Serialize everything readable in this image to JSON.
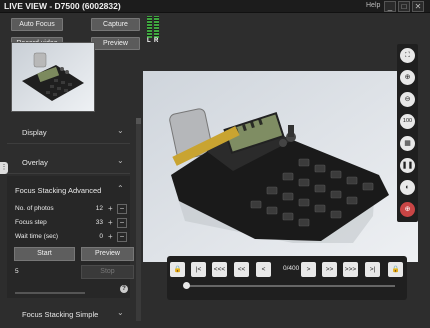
{
  "window": {
    "title": "LIVE VIEW - D7500 (6002832)",
    "help": "Help",
    "min": "_",
    "max": "□",
    "close": "✕"
  },
  "buttons": {
    "auto_focus": "Auto Focus",
    "capture": "Capture",
    "record_video": "Record video",
    "preview": "Preview"
  },
  "meter": {
    "left": "L",
    "right": "R"
  },
  "panels": {
    "display": "Display",
    "overlay": "Overlay",
    "focus_stacking_simple": "Focus Stacking Simple"
  },
  "focus_stacking_advanced": {
    "title": "Focus Stacking Advanced",
    "rows": [
      {
        "label": "No. of photos",
        "value": "12"
      },
      {
        "label": "Focus step",
        "value": "33"
      },
      {
        "label": "Wait time (sec)",
        "value": "0"
      }
    ],
    "start": "Start",
    "preview": "Preview",
    "stop": "Stop",
    "count": "5",
    "help": "?"
  },
  "playback": {
    "counter": "0/400",
    "lock": "🔒",
    "first": "|<",
    "prev_fast": "<<<",
    "prev2": "<<",
    "prev": "<",
    "next": ">",
    "next2": ">>",
    "next_fast": ">>>",
    "last": ">|"
  },
  "toolbar": {
    "zoom100": "100"
  },
  "colors": {
    "accent_red": "#c94545",
    "meter_green": "#3fa63f",
    "background": "#2d2d2d"
  }
}
